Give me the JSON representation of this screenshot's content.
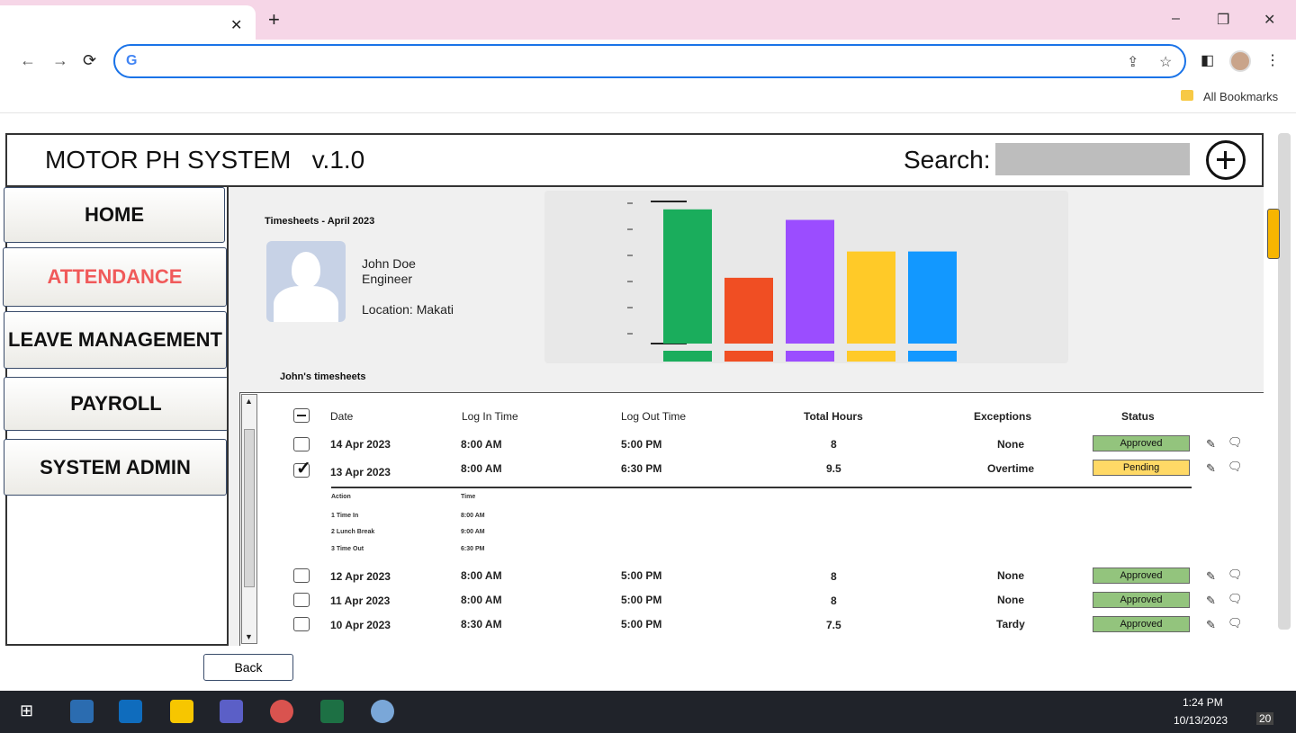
{
  "window": {
    "minimize": "–",
    "restore": "❐",
    "close": "✕"
  },
  "browser": {
    "new_tab": "+",
    "tab_close": "✕",
    "nav": {
      "back": "←",
      "forward": "→",
      "reload": "⟳"
    },
    "address": "",
    "bookmarks_label": "All Bookmarks"
  },
  "app": {
    "title": "MOTOR PH SYSTEM   v.1.0",
    "search_label": "Search:",
    "search_value": "",
    "sidebar": [
      "HOME",
      "ATTENDANCE",
      "LEAVE MANAGEMENT",
      "PAYROLL",
      "SYSTEM ADMIN"
    ],
    "active_item": "ATTENDANCE",
    "timesheet_title": "Timesheets - April 2023",
    "employee": {
      "name": "John Doe",
      "role": "Engineer",
      "location": "Location: Makati"
    },
    "table_title": "John's timesheets",
    "columns": [
      "Date",
      "Log In Time",
      "Log Out Time",
      "Total Hours",
      "Exceptions",
      "Status"
    ],
    "rows": [
      {
        "date": "14 Apr 2023",
        "login": "8:00 AM",
        "logout": "5:00 PM",
        "hours": "8",
        "exception": "None",
        "status": "Approved",
        "checked": false
      },
      {
        "date": "13 Apr 2023",
        "login": "8:00 AM",
        "logout": "6:30 PM",
        "hours": "9.5",
        "exception": "Overtime",
        "status": "Pending",
        "checked": true
      },
      {
        "date": "12 Apr 2023",
        "login": "8:00 AM",
        "logout": "5:00 PM",
        "hours": "8",
        "exception": "None",
        "status": "Approved",
        "checked": false
      },
      {
        "date": "11 Apr 2023",
        "login": "8:00 AM",
        "logout": "5:00 PM",
        "hours": "8",
        "exception": "None",
        "status": "Approved",
        "checked": false
      },
      {
        "date": "10 Apr 2023",
        "login": "8:30 AM",
        "logout": "5:00 PM",
        "hours": "7.5",
        "exception": "Tardy",
        "status": "Approved",
        "checked": false
      }
    ],
    "detail": {
      "headers": [
        "Action",
        "Time"
      ],
      "rows": [
        {
          "action": "1  Time In",
          "time": "8:00 AM"
        },
        {
          "action": "2  Lunch Break",
          "time": "9:00 AM"
        },
        {
          "action": "3  Time Out",
          "time": "6:30 PM"
        }
      ]
    },
    "back_label": "Back"
  },
  "chart_data": {
    "type": "bar",
    "values": [
      510,
      250,
      470,
      350,
      350
    ],
    "colors": [
      "#1aad5c",
      "#f04e23",
      "#9b4dff",
      "#ffca28",
      "#1298ff"
    ],
    "ylim": [
      0,
      540
    ]
  },
  "taskbar": {
    "time": "1:24 PM",
    "date": "10/13/2023",
    "notifications": "20"
  },
  "colors": {
    "accent": "#1a73e8",
    "active_nav": "#f05a5a",
    "approved": "#93c47d",
    "pending": "#ffd966"
  }
}
